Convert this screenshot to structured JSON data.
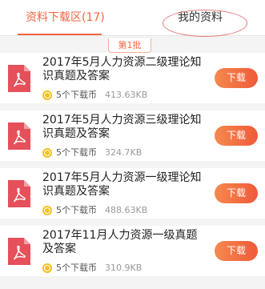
{
  "tabs": {
    "downloads": "资料下载区(17)",
    "mine": "我的资料"
  },
  "batch_label": "第1批",
  "items": [
    {
      "title": "2017年5月人力资源二级理论知识真题及答案",
      "price": "5个下载币",
      "size": "413.63KB",
      "button": "下载"
    },
    {
      "title": "2017年5月人力资源三级理论知识真题及答案",
      "price": "5个下载币",
      "size": "324.7KB",
      "button": "下载"
    },
    {
      "title": "2017年5月人力资源一级理论知识真题及答案",
      "price": "5个下载币",
      "size": "488.63KB",
      "button": "下载"
    },
    {
      "title": "2017年11月人力资源一级真题及答案",
      "price": "5个下载币",
      "size": "310.9KB",
      "button": "下载"
    }
  ],
  "icons": {
    "file": "pdf-file-icon",
    "coin": "coin-icon"
  },
  "colors": {
    "accent": "#f26640",
    "button_start": "#f4894e",
    "button_end": "#f05a3a",
    "pdf": "#e5505a",
    "coin": "#f3c11f"
  }
}
